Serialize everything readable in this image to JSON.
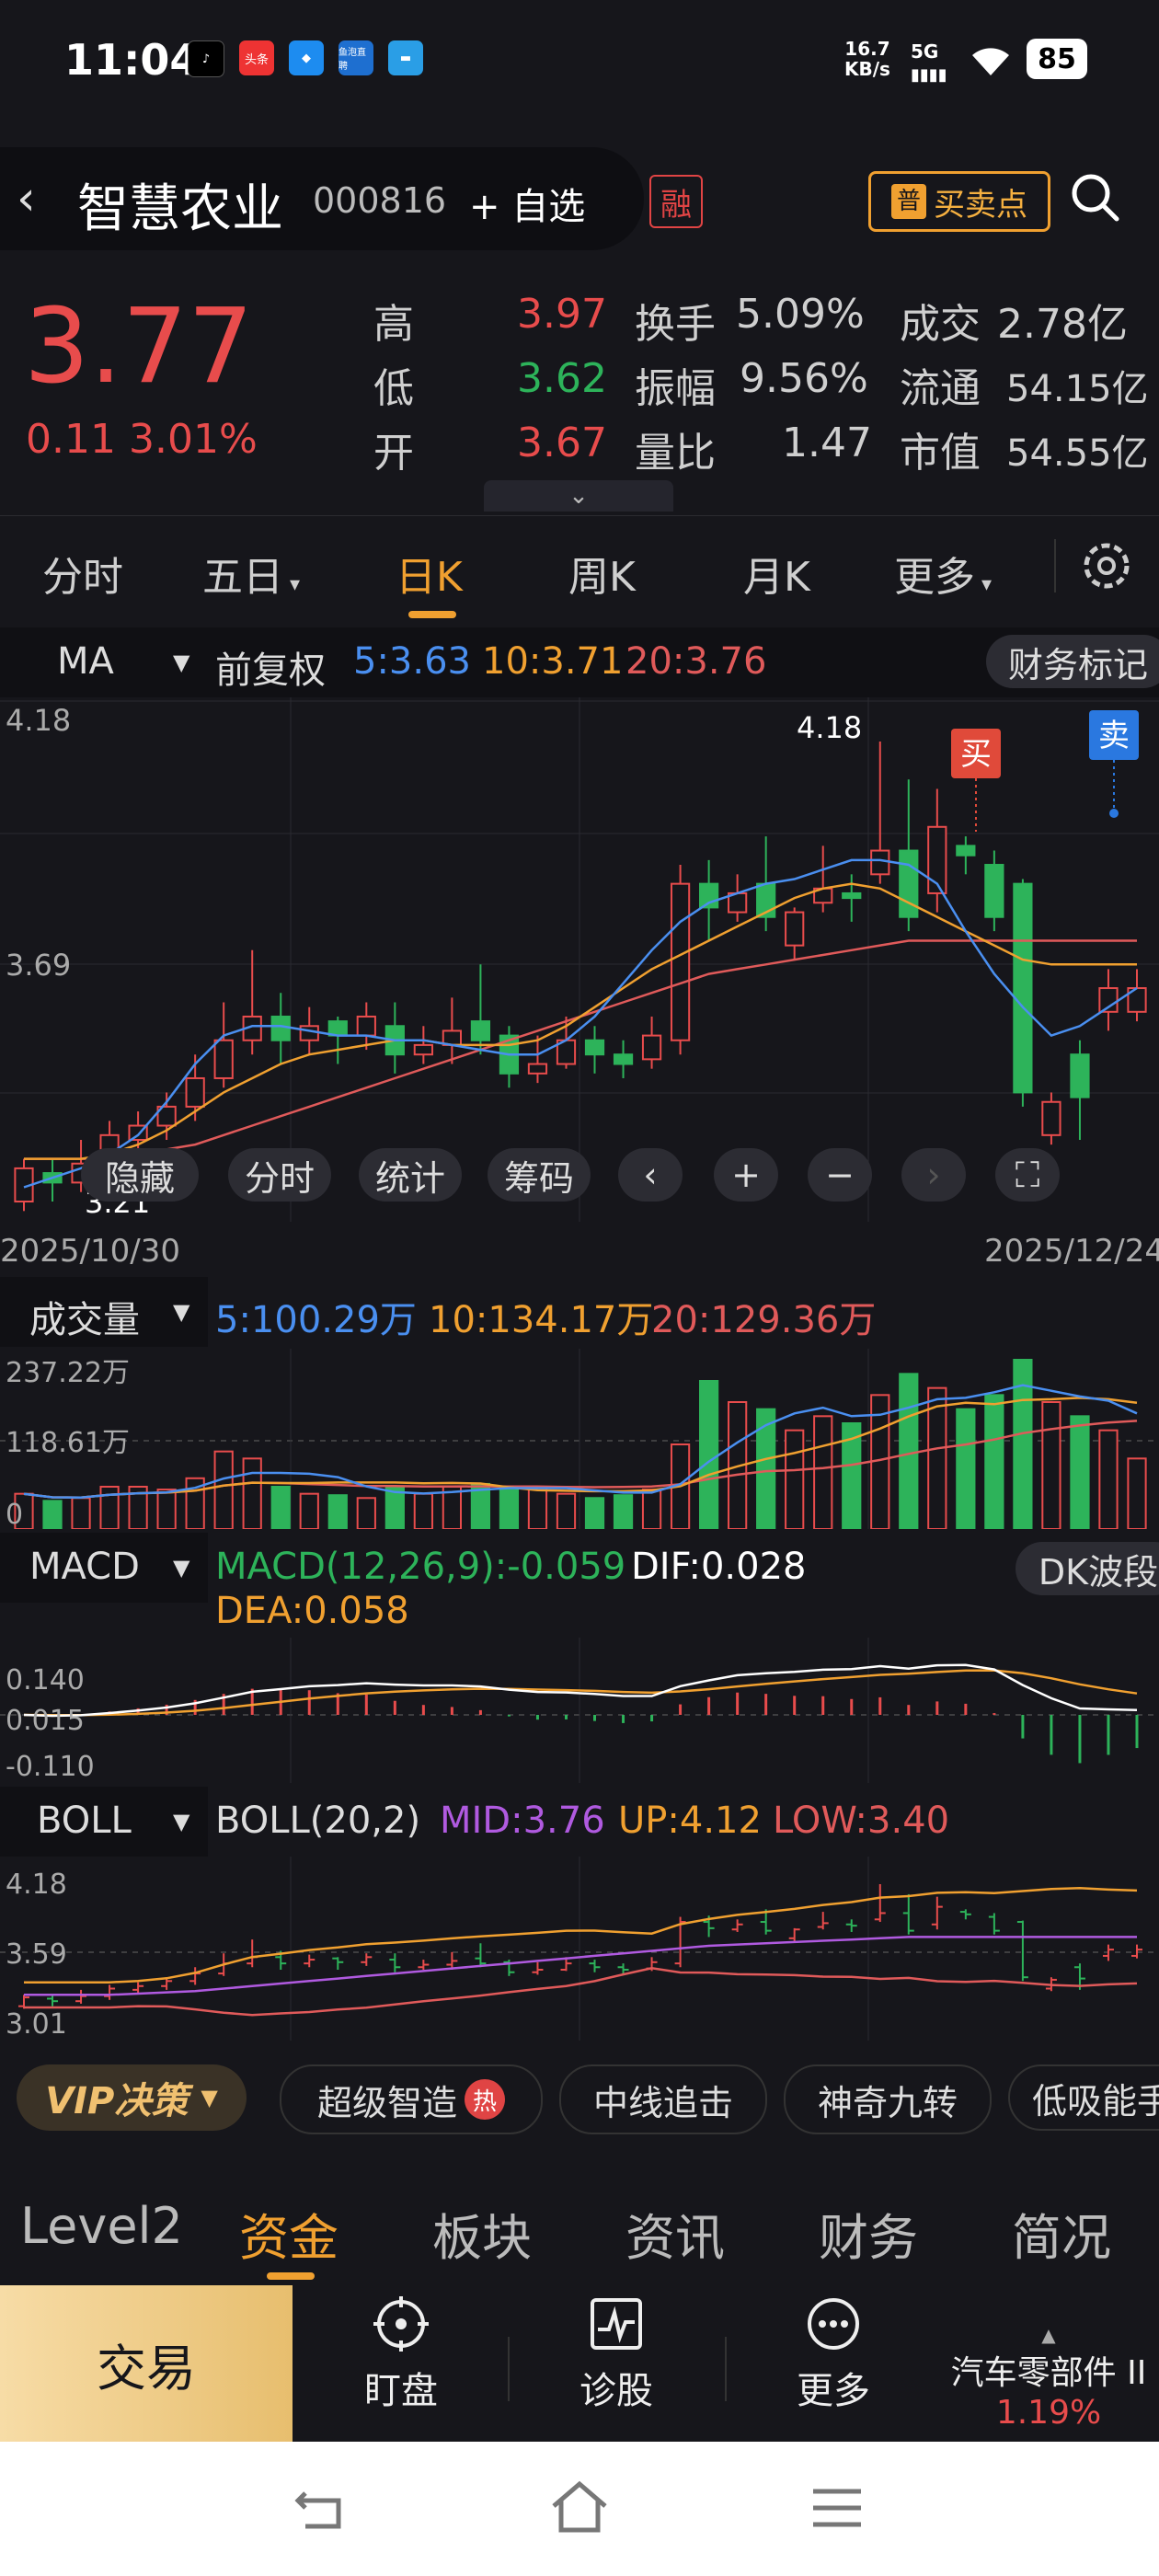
{
  "status_bar": {
    "time": "11:04",
    "speed": "16.7",
    "speed_unit": "KB/s",
    "network": "5G",
    "battery": "85",
    "app_icons": [
      "tiktok-icon",
      "toutiao-icon",
      "app-icon",
      "live-icon",
      "flag-icon"
    ],
    "toutiao_label": "头条",
    "live_label": "鱼泡直聘"
  },
  "header": {
    "back_icon": "back-arrow-icon",
    "stock_name": "智慧农业",
    "stock_code": "000816",
    "watch_label": "+ 自选",
    "margin_badge": "融",
    "buy_sell_badge_icon": "普",
    "buy_sell_label": "买卖点",
    "search_icon": "search-icon"
  },
  "quote": {
    "price": "3.77",
    "change": "0.11",
    "change_pct": "3.01%",
    "high_label": "高",
    "high": "3.97",
    "low_label": "低",
    "low": "3.62",
    "open_label": "开",
    "open": "3.67",
    "turnover_label": "换手",
    "turnover": "5.09%",
    "amplitude_label": "振幅",
    "amplitude": "9.56%",
    "vol_ratio_label": "量比",
    "vol_ratio": "1.47",
    "amount_label": "成交",
    "amount": "2.78亿",
    "float_label": "流通",
    "float": "54.15亿",
    "mktcap_label": "市值",
    "mktcap": "54.55亿"
  },
  "tabs": {
    "items": [
      "分时",
      "五日",
      "日K",
      "周K",
      "月K",
      "更多"
    ],
    "active": "日K"
  },
  "ma_bar": {
    "indicator": "MA",
    "adjust": "前复权",
    "ma5": "5:3.63",
    "ma10": "10:3.71",
    "ma20": "20:3.76",
    "finance_mark": "财务标记"
  },
  "kline": {
    "y_top": "4.18",
    "y_mid": "3.69",
    "y_bottom": "3.21",
    "high_label": "4.18",
    "low_label": "3.21",
    "buy_label": "买",
    "sell_label": "卖",
    "date_start": "2025/10/30",
    "date_end": "2025/12/24",
    "overlay_buttons": [
      "隐藏",
      "分时",
      "统计",
      "筹码"
    ]
  },
  "volume": {
    "label": "成交量",
    "ma5": "5:100.29万",
    "ma10": "10:134.17万",
    "ma20": "20:129.36万",
    "y_top": "237.22万",
    "y_mid": "118.61万",
    "y_bottom": "0"
  },
  "macd": {
    "label": "MACD",
    "params": "MACD(12,26,9):-0.059",
    "dif": "DIF:0.028",
    "dea": "DEA:0.058",
    "y_top": "0.140",
    "y_mid": "0.015",
    "y_bottom": "-0.110",
    "dk_button": "DK波段"
  },
  "boll": {
    "label": "BOLL",
    "params": "BOLL(20,2)",
    "mid": "MID:3.76",
    "up": "UP:4.12",
    "low": "LOW:3.40",
    "y_top": "4.18",
    "y_mid": "3.59",
    "y_bottom": "3.01"
  },
  "strategies": {
    "vip": "VIP决策",
    "items": [
      "超级智造",
      "中线追击",
      "神奇九转",
      "低吸能手"
    ],
    "hot_badge": "热"
  },
  "bottom_tabs": {
    "items": [
      "Level2",
      "资金",
      "板块",
      "资讯",
      "财务",
      "简况"
    ],
    "active": "资金"
  },
  "footer": {
    "trade": "交易",
    "items": [
      "盯盘",
      "诊股",
      "更多"
    ],
    "sector_name": "汽车零部件 II",
    "sector_change": "1.19%"
  },
  "colors": {
    "up": "#e84c4c",
    "down": "#2db35a",
    "accent": "#f0a030",
    "ma5": "#4a8ff0",
    "ma10": "#f0a030",
    "ma20": "#e05a5a",
    "boll_mid": "#b05ae0"
  },
  "chart_data": {
    "type": "candlestick",
    "categories_count": 40,
    "x_range": [
      "2025/10/30",
      "2025/12/24"
    ],
    "ylim": [
      3.21,
      4.18
    ],
    "candles": [
      [
        3.21,
        3.28,
        3.3,
        3.19
      ],
      [
        3.27,
        3.25,
        3.3,
        3.21
      ],
      [
        3.25,
        3.29,
        3.34,
        3.23
      ],
      [
        3.29,
        3.35,
        3.38,
        3.26
      ],
      [
        3.34,
        3.37,
        3.4,
        3.31
      ],
      [
        3.37,
        3.41,
        3.44,
        3.34
      ],
      [
        3.41,
        3.47,
        3.52,
        3.38
      ],
      [
        3.47,
        3.55,
        3.63,
        3.45
      ],
      [
        3.55,
        3.6,
        3.74,
        3.52
      ],
      [
        3.6,
        3.55,
        3.65,
        3.5
      ],
      [
        3.55,
        3.58,
        3.62,
        3.52
      ],
      [
        3.59,
        3.56,
        3.6,
        3.5
      ],
      [
        3.56,
        3.6,
        3.63,
        3.53
      ],
      [
        3.58,
        3.52,
        3.63,
        3.48
      ],
      [
        3.52,
        3.54,
        3.58,
        3.5
      ],
      [
        3.54,
        3.57,
        3.64,
        3.5
      ],
      [
        3.59,
        3.55,
        3.71,
        3.52
      ],
      [
        3.56,
        3.48,
        3.58,
        3.45
      ],
      [
        3.48,
        3.5,
        3.56,
        3.46
      ],
      [
        3.5,
        3.55,
        3.6,
        3.49
      ],
      [
        3.55,
        3.52,
        3.58,
        3.48
      ],
      [
        3.52,
        3.5,
        3.55,
        3.47
      ],
      [
        3.51,
        3.56,
        3.6,
        3.49
      ],
      [
        3.55,
        3.88,
        3.92,
        3.52
      ],
      [
        3.88,
        3.83,
        3.93,
        3.76
      ],
      [
        3.82,
        3.86,
        3.9,
        3.8
      ],
      [
        3.88,
        3.81,
        3.98,
        3.78
      ],
      [
        3.75,
        3.82,
        3.83,
        3.72
      ],
      [
        3.84,
        3.87,
        3.96,
        3.82
      ],
      [
        3.86,
        3.85,
        3.9,
        3.8
      ],
      [
        3.9,
        3.95,
        4.18,
        3.88
      ],
      [
        3.95,
        3.81,
        4.1,
        3.78
      ],
      [
        3.86,
        4.0,
        4.08,
        3.82
      ],
      [
        3.96,
        3.94,
        3.98,
        3.9
      ],
      [
        3.92,
        3.81,
        3.95,
        3.78
      ],
      [
        3.88,
        3.44,
        3.89,
        3.41
      ],
      [
        3.35,
        3.42,
        3.44,
        3.33
      ],
      [
        3.52,
        3.43,
        3.55,
        3.34
      ],
      [
        3.61,
        3.66,
        3.7,
        3.57
      ],
      [
        3.61,
        3.66,
        3.7,
        3.59
      ]
    ],
    "ma5": [
      3.24,
      3.26,
      3.28,
      3.31,
      3.35,
      3.42,
      3.5,
      3.56,
      3.58,
      3.58,
      3.57,
      3.56,
      3.56,
      3.55,
      3.55,
      3.54,
      3.53,
      3.52,
      3.52,
      3.55,
      3.6,
      3.67,
      3.74,
      3.8,
      3.84,
      3.86,
      3.88,
      3.89,
      3.91,
      3.93,
      3.93,
      3.92,
      3.88,
      3.78,
      3.69,
      3.62,
      3.56,
      3.58,
      3.62,
      3.66
    ],
    "ma10": [
      3.3,
      3.3,
      3.3,
      3.31,
      3.33,
      3.36,
      3.4,
      3.44,
      3.47,
      3.5,
      3.52,
      3.53,
      3.54,
      3.55,
      3.55,
      3.54,
      3.54,
      3.54,
      3.55,
      3.58,
      3.62,
      3.66,
      3.7,
      3.73,
      3.76,
      3.79,
      3.82,
      3.85,
      3.87,
      3.88,
      3.87,
      3.84,
      3.81,
      3.78,
      3.75,
      3.72,
      3.71,
      3.71,
      3.71,
      3.71
    ],
    "ma20": [
      3.3,
      3.3,
      3.3,
      3.3,
      3.31,
      3.32,
      3.33,
      3.35,
      3.37,
      3.39,
      3.41,
      3.43,
      3.45,
      3.47,
      3.49,
      3.51,
      3.53,
      3.55,
      3.57,
      3.59,
      3.61,
      3.63,
      3.65,
      3.67,
      3.69,
      3.7,
      3.71,
      3.72,
      3.73,
      3.74,
      3.75,
      3.76,
      3.76,
      3.76,
      3.76,
      3.76,
      3.76,
      3.76,
      3.76,
      3.76
    ],
    "volume": [
      25,
      20,
      22,
      30,
      30,
      28,
      36,
      55,
      50,
      30,
      25,
      24,
      22,
      30,
      25,
      30,
      32,
      28,
      30,
      25,
      22,
      24,
      28,
      60,
      105,
      90,
      85,
      70,
      80,
      75,
      95,
      110,
      100,
      85,
      95,
      120,
      90,
      80,
      70,
      50
    ]
  }
}
